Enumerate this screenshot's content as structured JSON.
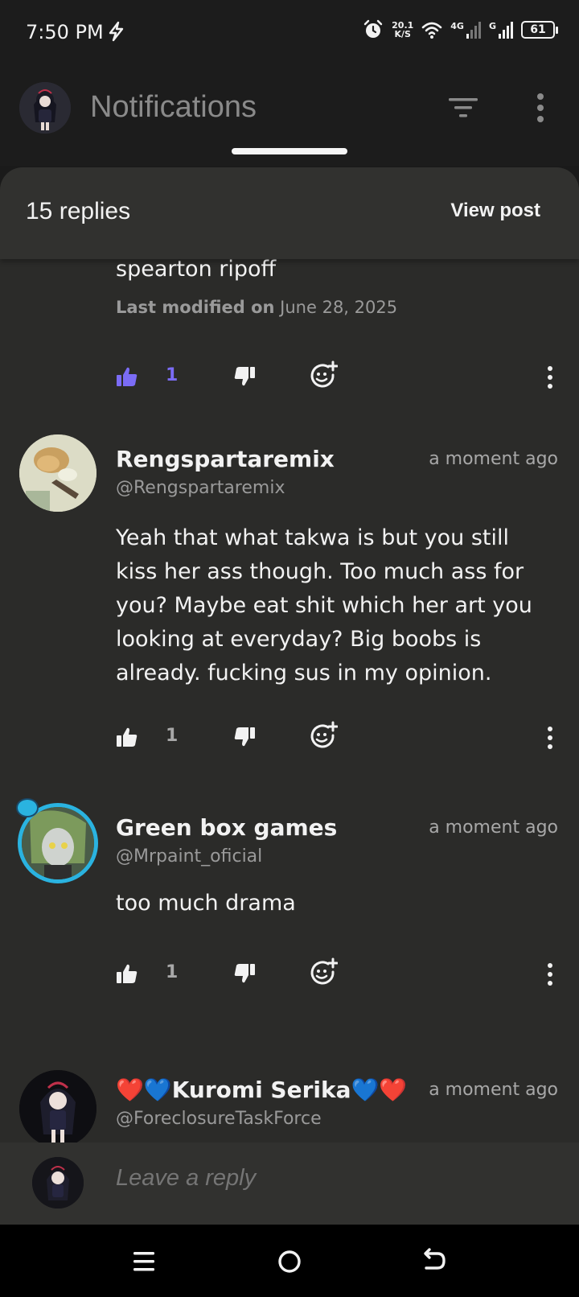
{
  "status": {
    "time": "7:50 PM",
    "net_speed_value": "20.1",
    "net_speed_unit": "K/S",
    "sim1_tag": "4G",
    "sim2_tag": "G",
    "battery": "61"
  },
  "header": {
    "title": "Notifications"
  },
  "sheet": {
    "replies_count": "15 replies",
    "view_post_label": "View post"
  },
  "comments": [
    {
      "body": "spearton ripoff",
      "modified_label": "Last modified on",
      "modified_date": "June 28, 2025",
      "likes": "1",
      "liked": true
    },
    {
      "author": "Rengspartaremix",
      "handle": "@Rengspartaremix",
      "time": "a moment ago",
      "body": "Yeah that what takwa is but you still kiss her ass though. Too much ass for you? Maybe eat shit which her art you looking at everyday? Big boobs is already. fucking sus in my opinion.",
      "likes": "1"
    },
    {
      "author": "Green box games",
      "handle": "@Mrpaint_oficial",
      "time": "a moment ago",
      "body": "too much drama",
      "likes": "1"
    },
    {
      "author": "❤️💙Kuromi Serika💙❤️",
      "handle": "@ForeclosureTaskForce",
      "time": "a moment ago"
    }
  ],
  "reply_bar": {
    "placeholder": "Leave a reply"
  },
  "colors": {
    "accent_like": "#7b6cf6",
    "sheet_bg": "#2b2b29",
    "header_bg": "#1c1c1c"
  }
}
